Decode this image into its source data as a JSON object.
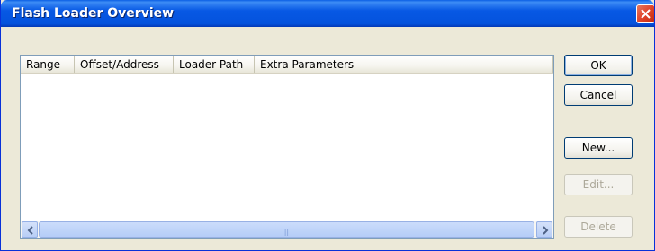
{
  "window": {
    "title": "Flash Loader Overview"
  },
  "list": {
    "columns": [
      "Range",
      "Offset/Address",
      "Loader Path",
      "Extra Parameters"
    ],
    "rows": []
  },
  "buttons": {
    "ok": "OK",
    "cancel": "Cancel",
    "new": "New...",
    "edit": "Edit...",
    "delete": "Delete"
  },
  "icons": {
    "close": "close-icon",
    "scroll_left": "chevron-left-icon",
    "scroll_right": "chevron-right-icon",
    "grip": "grip-icon"
  },
  "colors": {
    "titlebar": "#0458dd",
    "window_bg": "#ece9d8",
    "close": "#e1442a",
    "scroll": "#b8cef6"
  }
}
